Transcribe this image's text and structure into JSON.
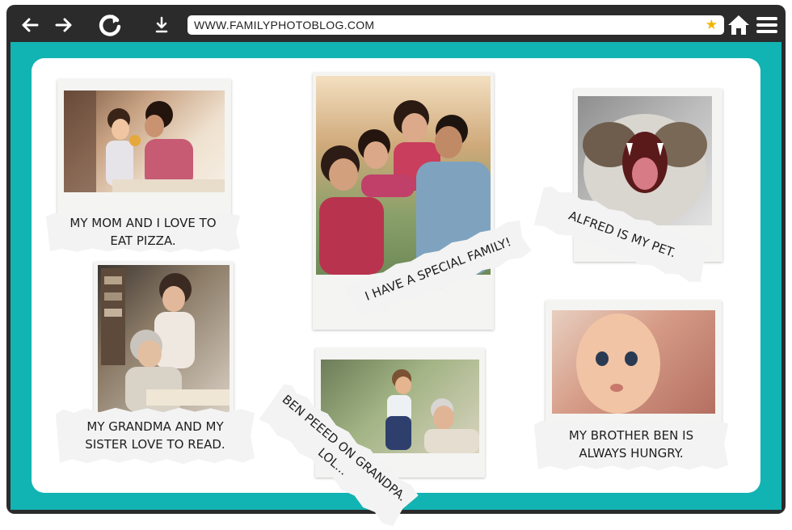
{
  "browser": {
    "url": "WWW.FAMILYPHOTOBLOG.COM",
    "icons": [
      "back-arrow-icon",
      "forward-arrow-icon",
      "reload-icon",
      "download-icon",
      "star-icon",
      "home-icon",
      "menu-icon"
    ]
  },
  "colors": {
    "frame": "#2b2b2b",
    "viewport": "#12b3b3",
    "board": "#ffffff",
    "star": "#f2b600"
  },
  "captions": {
    "mom_pizza": "MY MOM AND I LOVE TO EAT PIZZA.",
    "family": "I HAVE A SPECIAL FAMILY!",
    "pet": "ALFRED IS MY PET.",
    "grandma_read": "MY GRANDMA AND MY SISTER LOVE TO READ.",
    "ben_grandpa": "BEN PEEED ON GRANDPA. LOL...",
    "brother": "MY BROTHER BEN IS ALWAYS HUNGRY."
  }
}
